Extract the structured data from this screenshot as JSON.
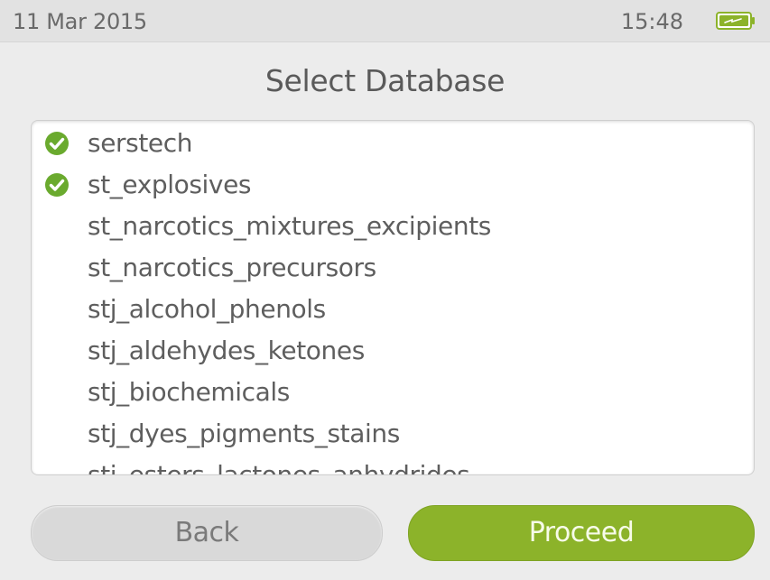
{
  "status_bar": {
    "date": "11 Mar 2015",
    "time": "15:48",
    "battery_icon": "battery-charging-icon"
  },
  "page": {
    "title": "Select Database"
  },
  "databases": [
    {
      "name": "serstech",
      "selected": true
    },
    {
      "name": "st_explosives",
      "selected": true
    },
    {
      "name": "st_narcotics_mixtures_excipients",
      "selected": false
    },
    {
      "name": "st_narcotics_precursors",
      "selected": false
    },
    {
      "name": "stj_alcohol_phenols",
      "selected": false
    },
    {
      "name": "stj_aldehydes_ketones",
      "selected": false
    },
    {
      "name": "stj_biochemicals",
      "selected": false
    },
    {
      "name": "stj_dyes_pigments_stains",
      "selected": false
    },
    {
      "name": "stj_esters_lactones_anhydrides",
      "selected": false
    }
  ],
  "buttons": {
    "back_label": "Back",
    "proceed_label": "Proceed"
  },
  "colors": {
    "accent": "#8cb32a",
    "check": "#6aaa2e",
    "background": "#ececec"
  }
}
